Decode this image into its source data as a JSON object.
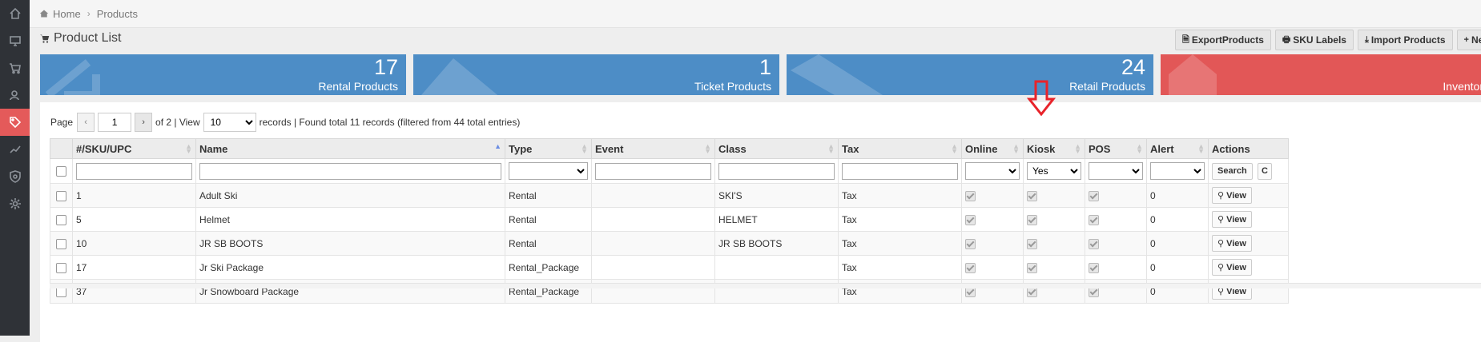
{
  "breadcrumb": {
    "home": "Home",
    "current": "Products"
  },
  "page": {
    "title": "Product List"
  },
  "toolbar": {
    "export": "ExportProducts",
    "sku_labels": "SKU Labels",
    "import": "Import Products",
    "new": "New"
  },
  "tiles": [
    {
      "count": "17",
      "label": "Rental Products",
      "color": "#4d8dc6"
    },
    {
      "count": "1",
      "label": "Ticket Products",
      "color": "#4d8dc6"
    },
    {
      "count": "24",
      "label": "Retail Products",
      "color": "#4d8dc6"
    },
    {
      "count": "",
      "label": "Inventory",
      "color": "#e25757"
    }
  ],
  "pager": {
    "page_label": "Page",
    "page_value": "1",
    "of_text": "of 2 | View",
    "per_page": "10",
    "records_text": "records | Found total 11 records (filtered from 44 total entries)"
  },
  "columns": [
    "#/SKU/UPC",
    "Name",
    "Type",
    "Event",
    "Class",
    "Tax",
    "Online",
    "Kiosk",
    "POS",
    "Alert",
    "Actions"
  ],
  "filters": {
    "kiosk": "Yes",
    "search_button": "Search"
  },
  "rows": [
    {
      "sku": "1",
      "name": "Adult Ski",
      "type": "Rental",
      "event": "",
      "class": "SKI'S",
      "tax": "Tax",
      "alert": "0",
      "action": "View"
    },
    {
      "sku": "5",
      "name": "Helmet",
      "type": "Rental",
      "event": "",
      "class": "HELMET",
      "tax": "Tax",
      "alert": "0",
      "action": "View"
    },
    {
      "sku": "10",
      "name": "JR SB BOOTS",
      "type": "Rental",
      "event": "",
      "class": "JR SB BOOTS",
      "tax": "Tax",
      "alert": "0",
      "action": "View"
    },
    {
      "sku": "17",
      "name": "Jr Ski Package",
      "type": "Rental_Package",
      "event": "",
      "class": "",
      "tax": "Tax",
      "alert": "0",
      "action": "View"
    },
    {
      "sku": "37",
      "name": "Jr Snowboard Package",
      "type": "Rental_Package",
      "event": "",
      "class": "",
      "tax": "Tax",
      "alert": "0",
      "action": "View"
    }
  ],
  "icons": {
    "sidebar": [
      "home-icon",
      "monitor-icon",
      "cart-icon",
      "users-icon",
      "tag-icon",
      "chart-icon",
      "shield-icon",
      "gear-icon"
    ],
    "accent": "#e45a5a"
  }
}
